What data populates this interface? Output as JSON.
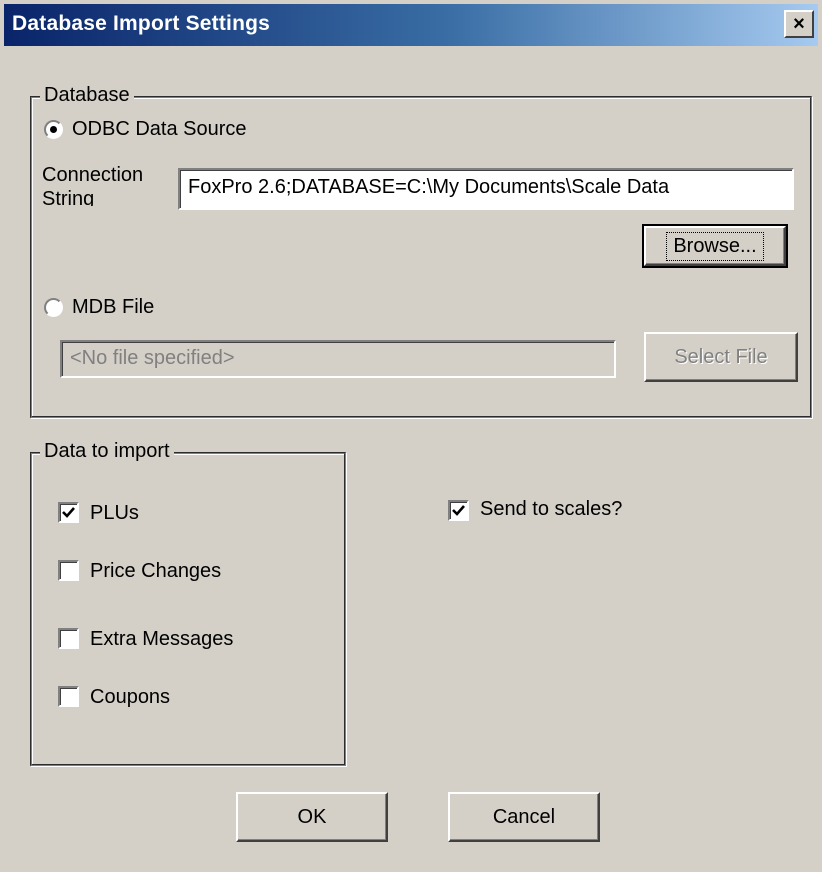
{
  "window": {
    "title": "Database Import Settings",
    "close_glyph": "×"
  },
  "database_group": {
    "legend": "Database",
    "odbc": {
      "label": "ODBC Data Source",
      "selected": true
    },
    "connection_label_1": "Connection",
    "connection_label_2": "String",
    "connection_value": "FoxPro 2.6;DATABASE=C:\\My Documents\\Scale Data",
    "browse_button": "Browse...",
    "mdb": {
      "label": "MDB File",
      "selected": false
    },
    "mdb_file_value": "<No file specified>",
    "select_file_button": "Select File"
  },
  "import_group": {
    "legend": "Data to import",
    "items": [
      {
        "label": "PLUs",
        "checked": true
      },
      {
        "label": "Price Changes",
        "checked": false
      },
      {
        "label": "Extra Messages",
        "checked": false
      },
      {
        "label": "Coupons",
        "checked": false
      }
    ]
  },
  "send_to_scales": {
    "label": "Send to scales?",
    "checked": true
  },
  "buttons": {
    "ok": "OK",
    "cancel": "Cancel"
  }
}
